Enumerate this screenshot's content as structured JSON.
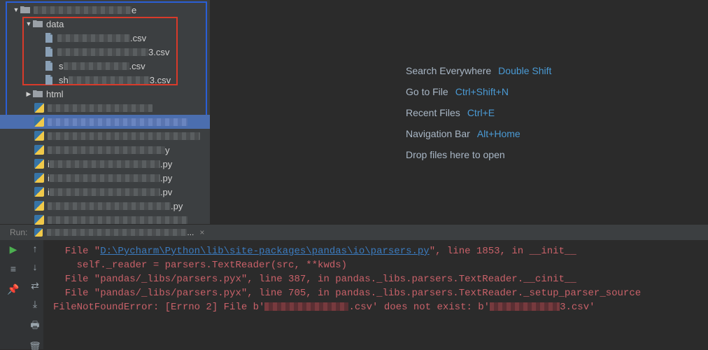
{
  "tree": {
    "root_dir_suffix": "e",
    "data_folder": "data",
    "csv1_suffix": ".csv",
    "csv2_suffix": "3.csv",
    "csv3_suffix": ".csv",
    "csv4_suffix": "3.csv",
    "html_folder": "html",
    "py5_suffix": "y",
    "py6_suffix": ".py",
    "py7_suffix": ".py",
    "py8_suffix": ".pv",
    "py9_suffix": ".py"
  },
  "hints": {
    "row1_label": "Search Everywhere",
    "row1_shortcut": "Double Shift",
    "row2_label": "Go to File",
    "row2_shortcut": "Ctrl+Shift+N",
    "row3_label": "Recent Files",
    "row3_shortcut": "Ctrl+E",
    "row4_label": "Navigation Bar",
    "row4_shortcut": "Alt+Home",
    "row5_label": "Drop files here to open"
  },
  "run": {
    "label": "Run:",
    "tab_suffix": "...",
    "close": "×"
  },
  "traceback": {
    "line1_prefix": "  File \"",
    "line1_link": "D:\\Pycharm\\Python\\lib\\site-packages\\pandas\\io\\parsers.py",
    "line1_suffix": "\", line 1853, in __init__",
    "line2": "    self._reader = parsers.TextReader(src, **kwds)",
    "line3": "  File \"pandas/_libs/parsers.pyx\", line 387, in pandas._libs.parsers.TextReader.__cinit__",
    "line4": "  File \"pandas/_libs/parsers.pyx\", line 705, in pandas._libs.parsers.TextReader._setup_parser_source",
    "line5_prefix": "FileNotFoundError: [Errno 2] File b'",
    "line5_mid": ".csv' does not exist: b'",
    "line5_suffix": "3.csv'"
  }
}
